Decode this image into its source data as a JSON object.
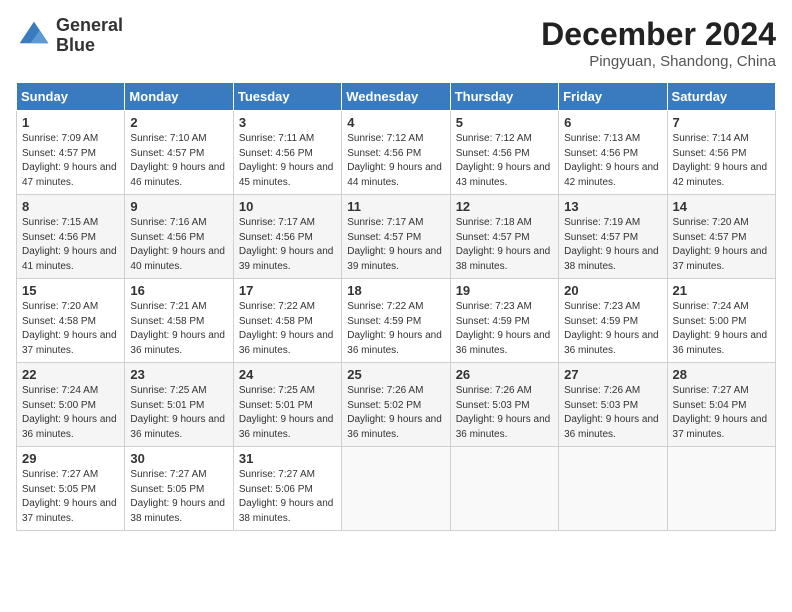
{
  "header": {
    "logo_line1": "General",
    "logo_line2": "Blue",
    "month": "December 2024",
    "location": "Pingyuan, Shandong, China"
  },
  "weekdays": [
    "Sunday",
    "Monday",
    "Tuesday",
    "Wednesday",
    "Thursday",
    "Friday",
    "Saturday"
  ],
  "weeks": [
    [
      {
        "day": "1",
        "sunrise": "7:09 AM",
        "sunset": "4:57 PM",
        "daylight": "9 hours and 47 minutes."
      },
      {
        "day": "2",
        "sunrise": "7:10 AM",
        "sunset": "4:57 PM",
        "daylight": "9 hours and 46 minutes."
      },
      {
        "day": "3",
        "sunrise": "7:11 AM",
        "sunset": "4:56 PM",
        "daylight": "9 hours and 45 minutes."
      },
      {
        "day": "4",
        "sunrise": "7:12 AM",
        "sunset": "4:56 PM",
        "daylight": "9 hours and 44 minutes."
      },
      {
        "day": "5",
        "sunrise": "7:12 AM",
        "sunset": "4:56 PM",
        "daylight": "9 hours and 43 minutes."
      },
      {
        "day": "6",
        "sunrise": "7:13 AM",
        "sunset": "4:56 PM",
        "daylight": "9 hours and 42 minutes."
      },
      {
        "day": "7",
        "sunrise": "7:14 AM",
        "sunset": "4:56 PM",
        "daylight": "9 hours and 42 minutes."
      }
    ],
    [
      {
        "day": "8",
        "sunrise": "7:15 AM",
        "sunset": "4:56 PM",
        "daylight": "9 hours and 41 minutes."
      },
      {
        "day": "9",
        "sunrise": "7:16 AM",
        "sunset": "4:56 PM",
        "daylight": "9 hours and 40 minutes."
      },
      {
        "day": "10",
        "sunrise": "7:17 AM",
        "sunset": "4:56 PM",
        "daylight": "9 hours and 39 minutes."
      },
      {
        "day": "11",
        "sunrise": "7:17 AM",
        "sunset": "4:57 PM",
        "daylight": "9 hours and 39 minutes."
      },
      {
        "day": "12",
        "sunrise": "7:18 AM",
        "sunset": "4:57 PM",
        "daylight": "9 hours and 38 minutes."
      },
      {
        "day": "13",
        "sunrise": "7:19 AM",
        "sunset": "4:57 PM",
        "daylight": "9 hours and 38 minutes."
      },
      {
        "day": "14",
        "sunrise": "7:20 AM",
        "sunset": "4:57 PM",
        "daylight": "9 hours and 37 minutes."
      }
    ],
    [
      {
        "day": "15",
        "sunrise": "7:20 AM",
        "sunset": "4:58 PM",
        "daylight": "9 hours and 37 minutes."
      },
      {
        "day": "16",
        "sunrise": "7:21 AM",
        "sunset": "4:58 PM",
        "daylight": "9 hours and 36 minutes."
      },
      {
        "day": "17",
        "sunrise": "7:22 AM",
        "sunset": "4:58 PM",
        "daylight": "9 hours and 36 minutes."
      },
      {
        "day": "18",
        "sunrise": "7:22 AM",
        "sunset": "4:59 PM",
        "daylight": "9 hours and 36 minutes."
      },
      {
        "day": "19",
        "sunrise": "7:23 AM",
        "sunset": "4:59 PM",
        "daylight": "9 hours and 36 minutes."
      },
      {
        "day": "20",
        "sunrise": "7:23 AM",
        "sunset": "4:59 PM",
        "daylight": "9 hours and 36 minutes."
      },
      {
        "day": "21",
        "sunrise": "7:24 AM",
        "sunset": "5:00 PM",
        "daylight": "9 hours and 36 minutes."
      }
    ],
    [
      {
        "day": "22",
        "sunrise": "7:24 AM",
        "sunset": "5:00 PM",
        "daylight": "9 hours and 36 minutes."
      },
      {
        "day": "23",
        "sunrise": "7:25 AM",
        "sunset": "5:01 PM",
        "daylight": "9 hours and 36 minutes."
      },
      {
        "day": "24",
        "sunrise": "7:25 AM",
        "sunset": "5:01 PM",
        "daylight": "9 hours and 36 minutes."
      },
      {
        "day": "25",
        "sunrise": "7:26 AM",
        "sunset": "5:02 PM",
        "daylight": "9 hours and 36 minutes."
      },
      {
        "day": "26",
        "sunrise": "7:26 AM",
        "sunset": "5:03 PM",
        "daylight": "9 hours and 36 minutes."
      },
      {
        "day": "27",
        "sunrise": "7:26 AM",
        "sunset": "5:03 PM",
        "daylight": "9 hours and 36 minutes."
      },
      {
        "day": "28",
        "sunrise": "7:27 AM",
        "sunset": "5:04 PM",
        "daylight": "9 hours and 37 minutes."
      }
    ],
    [
      {
        "day": "29",
        "sunrise": "7:27 AM",
        "sunset": "5:05 PM",
        "daylight": "9 hours and 37 minutes."
      },
      {
        "day": "30",
        "sunrise": "7:27 AM",
        "sunset": "5:05 PM",
        "daylight": "9 hours and 38 minutes."
      },
      {
        "day": "31",
        "sunrise": "7:27 AM",
        "sunset": "5:06 PM",
        "daylight": "9 hours and 38 minutes."
      },
      null,
      null,
      null,
      null
    ]
  ]
}
